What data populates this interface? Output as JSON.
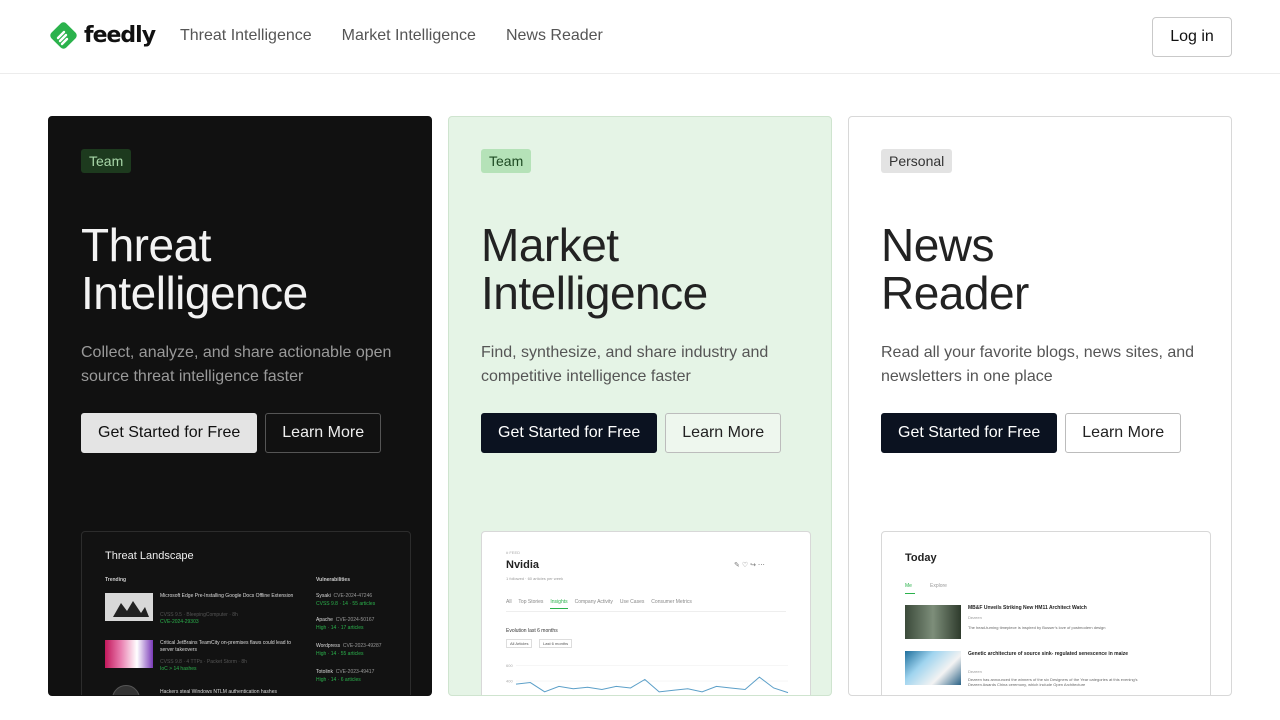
{
  "brand": {
    "name": "feedly",
    "accent": "#2bb24c"
  },
  "nav": {
    "items": [
      "Threat Intelligence",
      "Market Intelligence",
      "News Reader"
    ],
    "login": "Log in"
  },
  "cards": [
    {
      "badge": "Team",
      "title_line1": "Threat",
      "title_line2": "Intelligence",
      "description": "Collect, analyze, and share actionable open source threat intelligence faster",
      "primary": "Get Started for Free",
      "secondary": "Learn More",
      "preview": {
        "title": "Threat Landscape",
        "trending_label": "Trending",
        "vuln_label": "Vulnerabilities",
        "trending": [
          {
            "headline": "Microsoft Edge Pre-Installing Google Docs Offline Extension",
            "meta": "CVSS 9.5 · BleepingComputer · 8h",
            "cve": "CVE-2024-29303"
          },
          {
            "headline": "Critical JetBrains TeamCity on-premises flaws could lead to server takeovers",
            "meta": "CVSS 9.8 · 4 TTPs · Packet Storm · 8h",
            "cve": "IoC > 14 hashes"
          },
          {
            "headline": "Hackers steal Windows NTLM authentication hashes",
            "meta": "",
            "cve": ""
          }
        ],
        "vulns": [
          {
            "vendor": "Sysaki",
            "cve": "CVE-2024-47246",
            "meta": "CVSS 9.8 · 14 · 55 articles"
          },
          {
            "vendor": "Apache",
            "cve": "CVE-2024-50167",
            "meta": "High · 14 · 17 articles"
          },
          {
            "vendor": "Wordpress",
            "cve": "CVE-2023-49287",
            "meta": "High · 14 · 55 articles"
          },
          {
            "vendor": "Totolink",
            "cve": "CVE-2023-49417",
            "meta": "High · 14 · 6 articles"
          }
        ]
      }
    },
    {
      "badge": "Team",
      "title_line1": "Market",
      "title_line2": "Intelligence",
      "description": "Find, synthesize, and share industry and competitive intelligence faster",
      "primary": "Get Started for Free",
      "secondary": "Learn More",
      "preview": {
        "kicker": "# FEED",
        "title": "Nvidia",
        "subtitle": "1 followed · 60 articles per week",
        "tabs": [
          "All",
          "Top Stories",
          "Insights",
          "Company Activity",
          "Use Cases",
          "Consumer Metrics"
        ],
        "active_tab": "Insights",
        "chart_title": "Evolution last 6 months",
        "filter1": "All Articles",
        "filter2": "Last 6 months",
        "y_ticks": [
          "600",
          "400"
        ]
      }
    },
    {
      "badge": "Personal",
      "title_line1": "News",
      "title_line2": "Reader",
      "description": "Read all your favorite blogs, news sites, and newsletters in one place",
      "primary": "Get Started for Free",
      "secondary": "Learn More",
      "preview": {
        "title": "Today",
        "tabs": [
          "Me",
          "Explore"
        ],
        "articles": [
          {
            "headline": "MB&F Unveils Striking New HM11 Architect Watch",
            "source": "Dezeen",
            "snippet": "The head-turning timepiece is inspired by Busser's love of postmodern design"
          },
          {
            "headline": "Genetic architecture of source sink- regulated senescence in maize",
            "source": "Dezeen",
            "snippet": "Dezeen has announced the winners of the six Designers of the Year categories at this evening's Dezeen Awards China ceremony, which include Open Architecture"
          }
        ]
      }
    }
  ],
  "chart_data": {
    "type": "line",
    "title": "Evolution last 6 months",
    "xlabel": "",
    "ylabel": "",
    "y_ticks": [
      "600",
      "400"
    ],
    "ylim": [
      0,
      800
    ],
    "x": [
      1,
      2,
      3,
      4,
      5,
      6,
      7,
      8,
      9,
      10,
      11,
      12,
      13,
      14,
      15,
      16,
      17,
      18,
      19,
      20
    ],
    "values": [
      360,
      380,
      260,
      330,
      300,
      320,
      290,
      330,
      310,
      420,
      260,
      280,
      300,
      260,
      330,
      310,
      290,
      450,
      310,
      250
    ]
  }
}
